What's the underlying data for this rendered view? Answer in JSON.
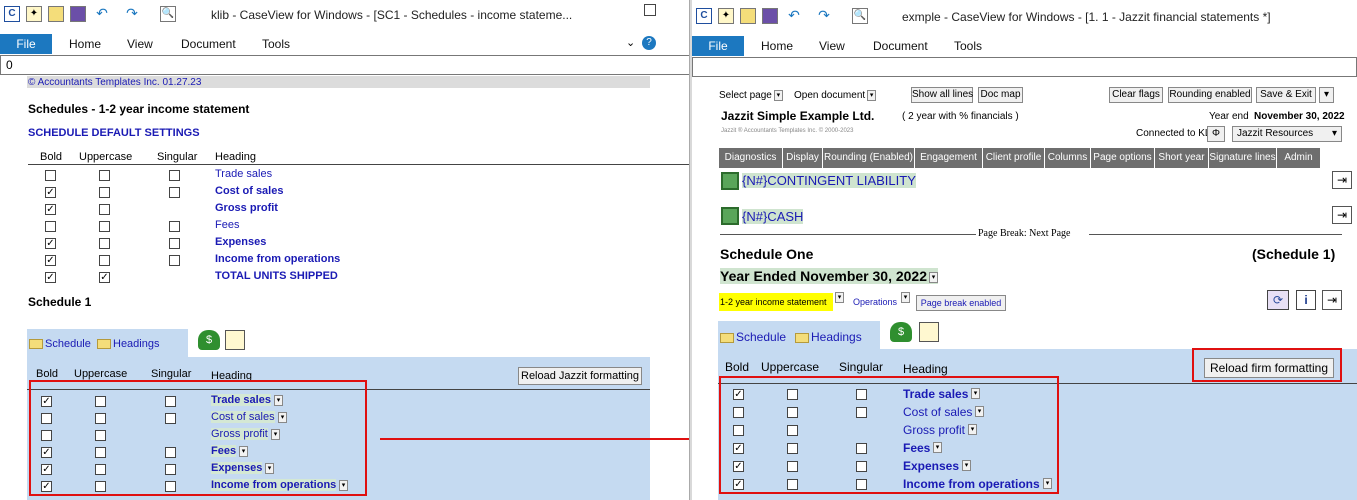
{
  "left": {
    "title": "klib - CaseView for Windows - [SC1 - Schedules - income stateme...",
    "ribbon_tabs": [
      "File",
      "Home",
      "View",
      "Document",
      "Tools"
    ],
    "formula_value": "0",
    "copyright": "© Accountants Templates Inc.  01.27.23",
    "heading": "Schedules - 1-2 year income statement",
    "defaults_title": "SCHEDULE DEFAULT SETTINGS",
    "columns": [
      "Bold",
      "Uppercase",
      "Singular",
      "Heading"
    ],
    "default_rows": [
      {
        "label": "Trade sales",
        "bold": false,
        "upper": false,
        "singular": false,
        "label_bold": false,
        "has_singular": true
      },
      {
        "label": "Cost of sales",
        "bold": true,
        "upper": false,
        "singular": false,
        "label_bold": true,
        "has_singular": true
      },
      {
        "label": "Gross profit",
        "bold": true,
        "upper": false,
        "singular": false,
        "label_bold": true,
        "has_singular": false
      },
      {
        "label": "Fees",
        "bold": false,
        "upper": false,
        "singular": false,
        "label_bold": false,
        "has_singular": true
      },
      {
        "label": "Expenses",
        "bold": true,
        "upper": false,
        "singular": false,
        "label_bold": true,
        "has_singular": true
      },
      {
        "label": "Income from operations",
        "bold": true,
        "upper": false,
        "singular": false,
        "label_bold": true,
        "has_singular": true
      },
      {
        "label": "TOTAL UNITS SHIPPED",
        "bold": true,
        "upper": true,
        "singular": false,
        "label_bold": true,
        "has_singular": false
      }
    ],
    "schedule_title": "Schedule 1",
    "tab_schedule": "Schedule",
    "tab_headings": "Headings",
    "reload_button": "Reload Jazzit formatting",
    "rows": [
      {
        "label": "Trade sales",
        "bold": true,
        "upper": false,
        "singular": false,
        "label_bold": true,
        "has_singular": true
      },
      {
        "label": "Cost of sales",
        "bold": false,
        "upper": false,
        "singular": false,
        "label_bold": false,
        "has_singular": true
      },
      {
        "label": "Gross profit",
        "bold": false,
        "upper": false,
        "singular": false,
        "label_bold": false,
        "has_singular": false
      },
      {
        "label": "Fees",
        "bold": true,
        "upper": false,
        "singular": false,
        "label_bold": true,
        "has_singular": true
      },
      {
        "label": "Expenses",
        "bold": true,
        "upper": false,
        "singular": false,
        "label_bold": true,
        "has_singular": true
      },
      {
        "label": "Income from operations",
        "bold": true,
        "upper": false,
        "singular": false,
        "label_bold": true,
        "has_singular": true
      }
    ]
  },
  "right": {
    "title": "exmple - CaseView for Windows - [1. 1 - Jazzit financial statements *]",
    "ribbon_tabs": [
      "File",
      "Home",
      "View",
      "Document",
      "Tools"
    ],
    "select_page": "Select page",
    "open_document": "Open document",
    "show_all_lines": "Show all lines",
    "doc_map": "Doc map",
    "clear_flags": "Clear flags",
    "rounding_enabled": "Rounding enabled",
    "save_exit": "Save & Exit",
    "company": "Jazzit Simple Example Ltd.",
    "company_sub": "( 2 year with % financials )",
    "year_end_label": "Year end",
    "year_end_value": "November 30, 2022",
    "copyright": "Jazzit ® Accountants Templates Inc. © 2000-2023",
    "connected": "Connected to KLIB",
    "resources": "Jazzit Resources",
    "nav_tabs": [
      "Diagnostics",
      "Display",
      "Rounding (Enabled)",
      "Engagement",
      "Client profile",
      "Columns",
      "Page options",
      "Short year",
      "Signature lines",
      "Admin"
    ],
    "contingent": "{N#}CONTINGENT LIABILITY",
    "cash": "{N#}CASH",
    "page_break": "Page Break: Next Page",
    "schedule_one": "Schedule One",
    "schedule_one_ref": "(Schedule 1)",
    "year_ended": "Year Ended November 30, 2022",
    "statement_select": "1-2 year income statement",
    "operations": "Operations",
    "page_break_enabled": "Page break enabled",
    "tab_schedule": "Schedule",
    "tab_headings": "Headings",
    "reload_button": "Reload firm formatting",
    "columns": [
      "Bold",
      "Uppercase",
      "Singular",
      "Heading"
    ],
    "rows": [
      {
        "label": "Trade sales",
        "bold": true,
        "upper": false,
        "singular": false,
        "label_bold": true,
        "has_singular": true
      },
      {
        "label": "Cost of sales",
        "bold": false,
        "upper": false,
        "singular": false,
        "label_bold": false,
        "has_singular": true
      },
      {
        "label": "Gross profit",
        "bold": false,
        "upper": false,
        "singular": false,
        "label_bold": false,
        "has_singular": false
      },
      {
        "label": "Fees",
        "bold": true,
        "upper": false,
        "singular": false,
        "label_bold": true,
        "has_singular": true
      },
      {
        "label": "Expenses",
        "bold": true,
        "upper": false,
        "singular": false,
        "label_bold": true,
        "has_singular": true
      },
      {
        "label": "Income from operations",
        "bold": true,
        "upper": false,
        "singular": false,
        "label_bold": true,
        "has_singular": true
      }
    ]
  },
  "colors": {
    "accent": "#1c78c0",
    "highlight_blue": "#c5daf1",
    "yellow": "#ffff00",
    "annotation_red": "#e01010",
    "heading_blue": "#1a1ab4"
  }
}
